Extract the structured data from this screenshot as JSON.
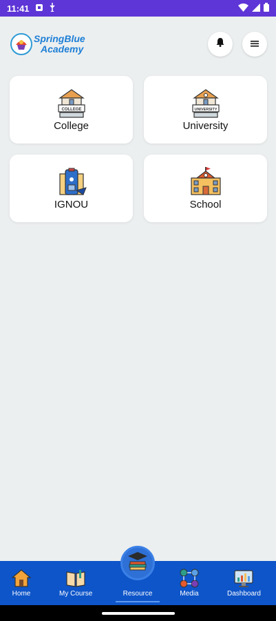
{
  "status_bar": {
    "time": "11:41",
    "icons_left": [
      "notification-icon",
      "usb-icon"
    ],
    "icons_right": [
      "wifi-icon",
      "signal-icon",
      "battery-icon"
    ],
    "bg": "#5e35d6"
  },
  "header": {
    "logo_line1": "SpringBlue",
    "logo_line2": "Academy",
    "brand_color": "#1d7fd6",
    "bell_icon": "bell-icon",
    "menu_icon": "menu-icon"
  },
  "categories": [
    {
      "label": "College",
      "icon": "college-icon"
    },
    {
      "label": "University",
      "icon": "university-icon"
    },
    {
      "label": "IGNOU",
      "icon": "ignou-icon"
    },
    {
      "label": "School",
      "icon": "school-icon"
    }
  ],
  "bottom_nav": {
    "bg": "#0e55c9",
    "items": [
      {
        "label": "Home",
        "icon": "home-icon"
      },
      {
        "label": "My Course",
        "icon": "book-icon"
      },
      {
        "label": "Resource",
        "icon": "resource-icon",
        "active": true
      },
      {
        "label": "Media",
        "icon": "media-icon"
      },
      {
        "label": "Dashboard",
        "icon": "dashboard-icon"
      }
    ]
  }
}
